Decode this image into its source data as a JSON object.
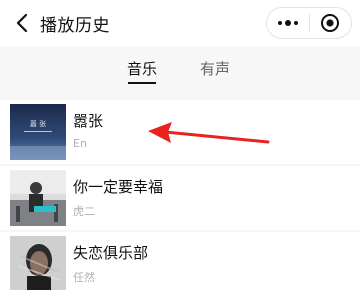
{
  "header": {
    "title": "播放历史",
    "back_icon": "chevron-left-icon",
    "more_icon": "more-dots-icon",
    "close_icon": "target-circle-icon"
  },
  "tabs": [
    {
      "label": "音乐",
      "active": true
    },
    {
      "label": "有声",
      "active": false
    }
  ],
  "songs": [
    {
      "title": "嚣张",
      "artist": "En",
      "cover_text": "嚣 张"
    },
    {
      "title": "你一定要幸福",
      "artist": "虎二"
    },
    {
      "title": "失恋俱乐部",
      "artist": "任然"
    }
  ],
  "annotation": {
    "type": "red-arrow",
    "color": "#e8231f",
    "points_to": "嚣张"
  },
  "colors": {
    "accent": "#111111",
    "background": "#f6f6f6",
    "subtext": "#b0b0b0"
  }
}
